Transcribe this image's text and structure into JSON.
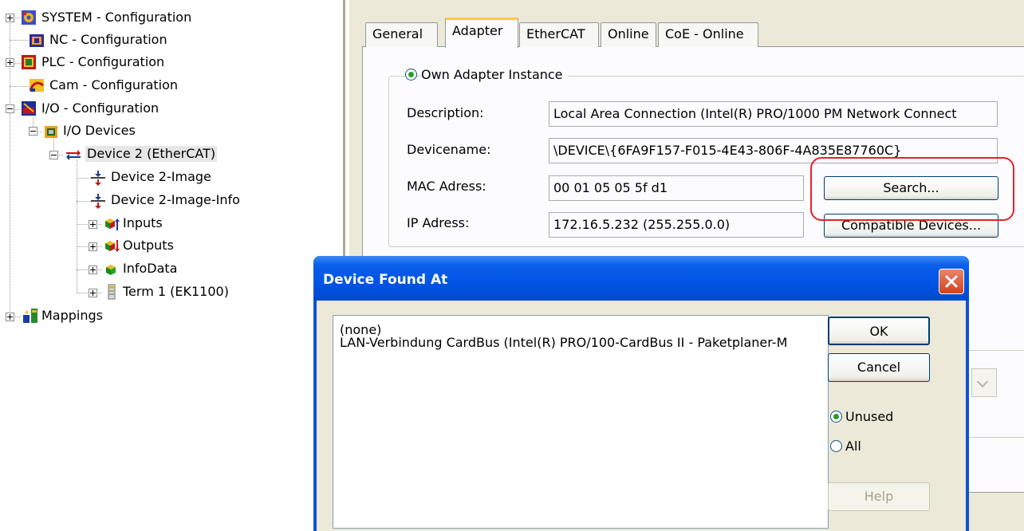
{
  "tree": {
    "items": [
      {
        "label": "SYSTEM - Configuration"
      },
      {
        "label": "NC - Configuration"
      },
      {
        "label": "PLC - Configuration"
      },
      {
        "label": "Cam - Configuration"
      },
      {
        "label": "I/O - Configuration"
      },
      {
        "label": "I/O Devices"
      },
      {
        "label": "Device 2 (EtherCAT)"
      },
      {
        "label": "Device 2-Image"
      },
      {
        "label": "Device 2-Image-Info"
      },
      {
        "label": "Inputs"
      },
      {
        "label": "Outputs"
      },
      {
        "label": "InfoData"
      },
      {
        "label": "Term 1 (EK1100)"
      },
      {
        "label": "Mappings"
      }
    ]
  },
  "tabs": [
    {
      "label": "General"
    },
    {
      "label": "Adapter"
    },
    {
      "label": "EtherCAT"
    },
    {
      "label": "Online"
    },
    {
      "label": "CoE - Online"
    }
  ],
  "adapter": {
    "own_instance_label": "Own Adapter Instance",
    "description_label": "Description:",
    "description_value": "Local Area Connection (Intel(R) PRO/1000 PM Network Connect",
    "devicename_label": "Devicename:",
    "devicename_value": "\\DEVICE\\{6FA9F157-F015-4E43-806F-4A835E87760C}",
    "mac_label": "MAC Adress:",
    "mac_value": "00 01 05 05 5f d1",
    "ip_label": "IP Adress:",
    "ip_value": "172.16.5.232 (255.255.0.0)",
    "search_button": "Search...",
    "compatible_button": "Compatible Devices..."
  },
  "dialog": {
    "title": "Device Found At",
    "list": [
      "(none)",
      "LAN-Verbindung CardBus (Intel(R) PRO/100-CardBus II - Paketplaner-M"
    ],
    "ok": "OK",
    "cancel": "Cancel",
    "filter_unused": "Unused",
    "filter_all": "All",
    "help": "Help",
    "filter_selected": "Unused"
  },
  "colors": {
    "title_bar": "#0054e3",
    "close_button": "#d1411f",
    "tab_accent": "#ffc83c",
    "highlight": "#e8202a",
    "radio_dot": "#21a121"
  }
}
